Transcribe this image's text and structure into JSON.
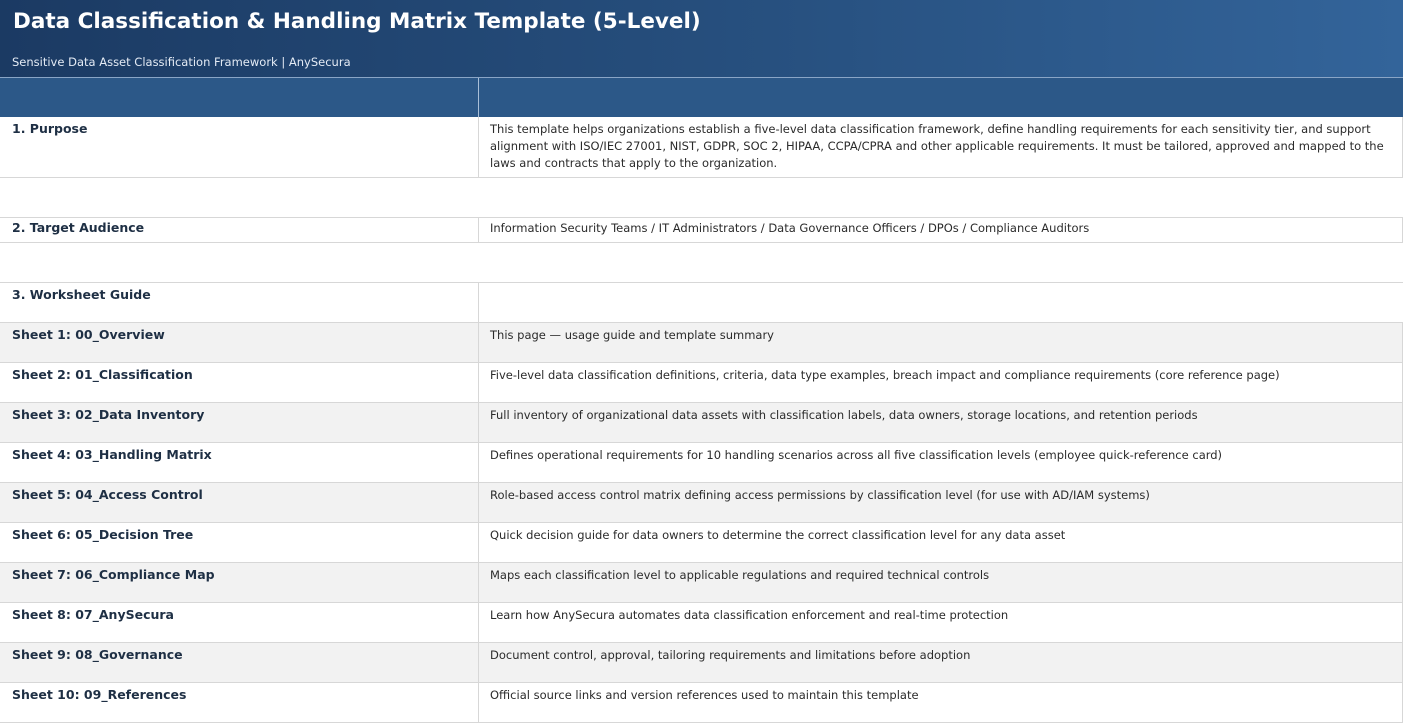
{
  "header": {
    "title": "Data Classification & Handling Matrix Template (5-Level)",
    "subtitle": "Sensitive Data Asset Classification Framework | AnySecura"
  },
  "purpose": {
    "label": "1. Purpose",
    "text": "This template helps organizations establish a five-level data classification framework, define handling requirements for each sensitivity tier, and support alignment with ISO/IEC 27001, NIST, GDPR, SOC 2, HIPAA, CCPA/CPRA and other applicable requirements. It must be tailored, approved and mapped to the laws and contracts that apply to the organization."
  },
  "audience": {
    "label": "2. Target Audience",
    "text": "Information Security Teams / IT Administrators / Data Governance Officers / DPOs / Compliance Auditors"
  },
  "guide": {
    "label": "3. Worksheet Guide",
    "sheets": [
      {
        "label": "Sheet 1: 00_Overview",
        "desc": "This page — usage guide and template summary"
      },
      {
        "label": "Sheet 2: 01_Classification",
        "desc": "Five-level data classification definitions, criteria, data type examples, breach impact and compliance requirements (core reference page)"
      },
      {
        "label": "Sheet 3: 02_Data Inventory",
        "desc": "Full inventory of organizational data assets with classification labels, data owners, storage locations, and retention periods"
      },
      {
        "label": "Sheet 4: 03_Handling Matrix",
        "desc": "Defines operational requirements for 10 handling scenarios across all five classification levels (employee quick-reference card)"
      },
      {
        "label": "Sheet 5: 04_Access Control",
        "desc": "Role-based access control matrix defining access permissions by classification level (for use with AD/IAM systems)"
      },
      {
        "label": "Sheet 6: 05_Decision Tree",
        "desc": "Quick decision guide for data owners to determine the correct classification level for any data asset"
      },
      {
        "label": "Sheet 7: 06_Compliance Map",
        "desc": "Maps each classification level to applicable regulations and required technical controls"
      },
      {
        "label": "Sheet 8: 07_AnySecura",
        "desc": "Learn how AnySecura automates data classification enforcement and real-time protection"
      },
      {
        "label": "Sheet 9: 08_Governance",
        "desc": "Document control, approval, tailoring requirements and limitations before adoption"
      },
      {
        "label": "Sheet 10: 09_References",
        "desc": "Official source links and version references used to maintain this template"
      }
    ]
  }
}
